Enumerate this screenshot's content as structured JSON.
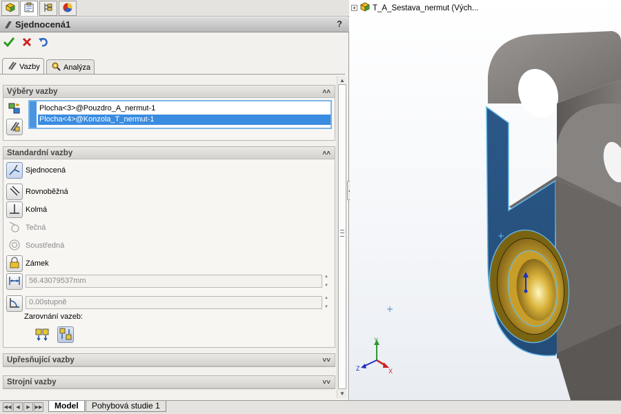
{
  "top_tabs": [
    {
      "icon": "feature-manager-icon",
      "active": false
    },
    {
      "icon": "property-manager-icon",
      "active": true
    },
    {
      "icon": "configuration-manager-icon",
      "active": false
    },
    {
      "icon": "display-manager-icon",
      "active": false
    }
  ],
  "property_manager": {
    "title": "Sjednocená1",
    "help": "?",
    "actions": {
      "ok": "ok-check-icon",
      "cancel": "cancel-x-icon",
      "undo": "undo-icon"
    },
    "tabs": [
      {
        "label": "Vazby",
        "icon": "paperclip-icon",
        "active": true
      },
      {
        "label": "Analýza",
        "icon": "analysis-gear-icon",
        "active": false
      }
    ]
  },
  "mate_selections": {
    "title": "Výběry vazby",
    "items": [
      {
        "label": "Plocha<3>@Pouzdro_A_nermut-1",
        "selected": false
      },
      {
        "label": "Plocha<4>@Konzola_T_nermut-1",
        "selected": true
      }
    ]
  },
  "standard_mates": {
    "title": "Standardní vazby",
    "mates": [
      {
        "label": "Sjednocená",
        "icon": "coincident-icon",
        "active": true,
        "enabled": true
      },
      {
        "label": "Rovnoběžná",
        "icon": "parallel-icon",
        "active": false,
        "enabled": true
      },
      {
        "label": "Kolmá",
        "icon": "perpendicular-icon",
        "active": false,
        "enabled": true
      },
      {
        "label": "Tečná",
        "icon": "tangent-icon",
        "active": false,
        "enabled": false
      },
      {
        "label": "Soustředná",
        "icon": "concentric-icon",
        "active": false,
        "enabled": false
      },
      {
        "label": "Zámek",
        "icon": "lock-icon",
        "active": false,
        "enabled": true
      }
    ],
    "distance_value": "56.43079537mm",
    "angle_value": "0.00stupně",
    "alignment_label": "Zarovnání vazeb:"
  },
  "advanced_mates": {
    "title": "Upřesňující vazby"
  },
  "mechanical_mates": {
    "title": "Strojní vazby"
  },
  "bottom_tabs": [
    {
      "label": "Model",
      "active": true
    },
    {
      "label": "Pohybová studie 1",
      "active": false
    }
  ],
  "viewport": {
    "tree_label": "T_A_Sestava_nermut  (Vých...",
    "triad": {
      "x": "X",
      "y": "Y",
      "z": "Z"
    },
    "colors": {
      "part_face": "#2f5f8f",
      "part_gray": "#7a7775",
      "bushing": "#c9a227",
      "highlight": "#66bbee"
    }
  }
}
